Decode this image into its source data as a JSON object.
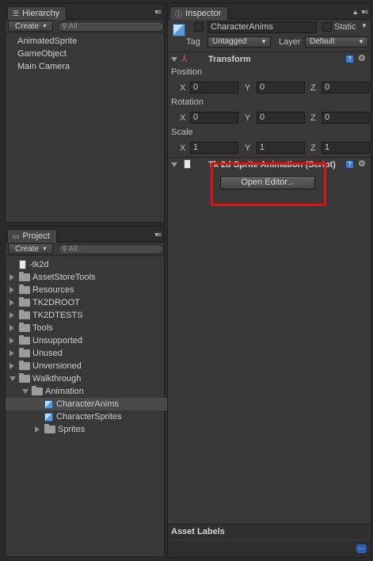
{
  "hierarchy": {
    "tab_label": "Hierarchy",
    "create_label": "Create",
    "search_placeholder": "All",
    "items": [
      "AnimatedSprite",
      "GameObject",
      "Main Camera"
    ]
  },
  "project": {
    "tab_label": "Project",
    "create_label": "Create",
    "search_placeholder": "All",
    "items": [
      {
        "label": "-tk2d",
        "type": "file",
        "depth": 0,
        "arrow": "none"
      },
      {
        "label": "AssetStoreTools",
        "type": "folder",
        "depth": 0,
        "arrow": "right"
      },
      {
        "label": "Resources",
        "type": "folder",
        "depth": 0,
        "arrow": "right"
      },
      {
        "label": "TK2DROOT",
        "type": "folder",
        "depth": 0,
        "arrow": "right"
      },
      {
        "label": "TK2DTESTS",
        "type": "folder",
        "depth": 0,
        "arrow": "right"
      },
      {
        "label": "Tools",
        "type": "folder",
        "depth": 0,
        "arrow": "right"
      },
      {
        "label": "Unsupported",
        "type": "folder",
        "depth": 0,
        "arrow": "right"
      },
      {
        "label": "Unused",
        "type": "folder",
        "depth": 0,
        "arrow": "right"
      },
      {
        "label": "Unversioned",
        "type": "folder",
        "depth": 0,
        "arrow": "right"
      },
      {
        "label": "Walkthrough",
        "type": "folder",
        "depth": 0,
        "arrow": "down"
      },
      {
        "label": "Animation",
        "type": "folder",
        "depth": 1,
        "arrow": "down"
      },
      {
        "label": "CharacterAnims",
        "type": "prefab",
        "depth": 2,
        "arrow": "none",
        "selected": true
      },
      {
        "label": "CharacterSprites",
        "type": "prefab",
        "depth": 2,
        "arrow": "none"
      },
      {
        "label": "Sprites",
        "type": "folder",
        "depth": 2,
        "arrow": "right"
      }
    ]
  },
  "inspector": {
    "tab_label": "Inspector",
    "object_name": "CharacterAnims",
    "static_label": "Static",
    "tag_label": "Tag",
    "tag_value": "Untagged",
    "layer_label": "Layer",
    "layer_value": "Default",
    "transform": {
      "title": "Transform",
      "position_label": "Position",
      "rotation_label": "Rotation",
      "scale_label": "Scale",
      "x_label": "X",
      "y_label": "Y",
      "z_label": "Z",
      "position": [
        "0",
        "0",
        "0"
      ],
      "rotation": [
        "0",
        "0",
        "0"
      ],
      "scale": [
        "1",
        "1",
        "1"
      ]
    },
    "sprite_anim": {
      "title": "Tk 2d Sprite Animation (Script)",
      "open_editor_label": "Open Editor..."
    },
    "asset_labels": "Asset Labels"
  },
  "colors": {
    "highlight_box": "#e01010",
    "selection": "#4a4a4a",
    "help_icon": "#3f78c4"
  }
}
